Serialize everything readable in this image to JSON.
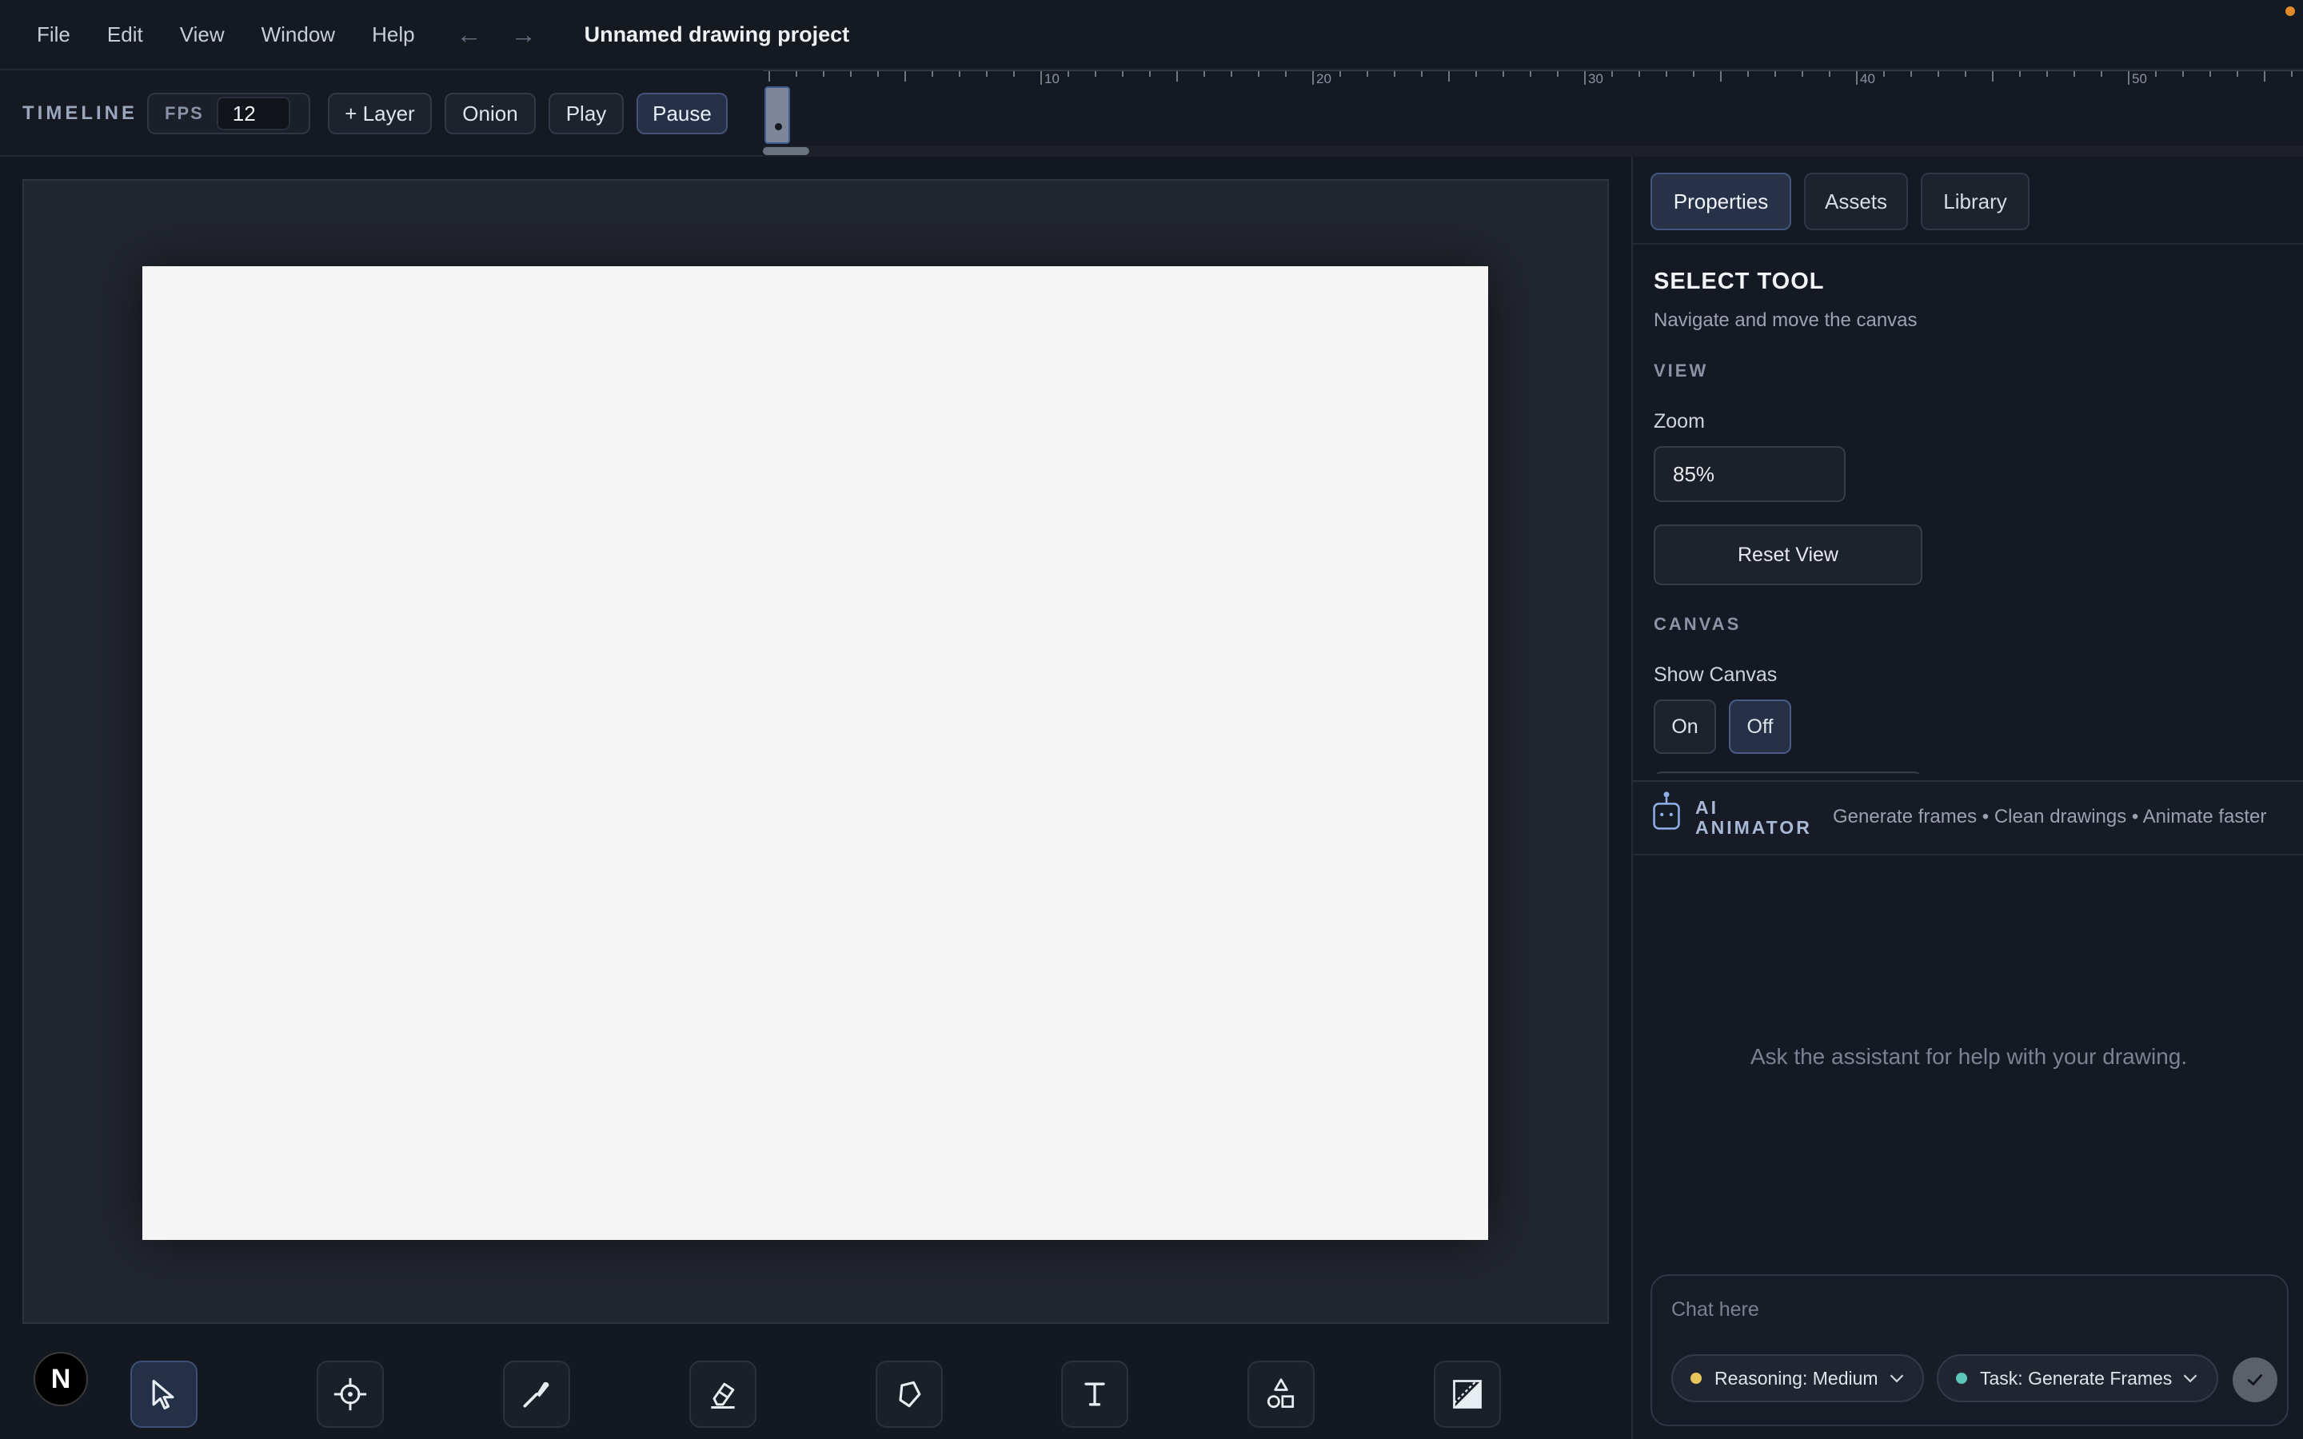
{
  "menu": {
    "items": [
      "File",
      "Edit",
      "View",
      "Window",
      "Help"
    ],
    "undo_glyph": "←",
    "redo_glyph": "→",
    "project_title": "Unnamed drawing project",
    "status_color": "#e58a2c"
  },
  "timeline": {
    "label": "TIMELINE",
    "fps_label": "FPS",
    "fps_value": "12",
    "buttons": {
      "add_layer": "+ Layer",
      "onion": "Onion",
      "play": "Play",
      "pause": "Pause"
    },
    "active_button": "pause",
    "ruler_labels": [
      "10",
      "20",
      "30",
      "40",
      "50"
    ],
    "current_frame": 1
  },
  "toolbar": {
    "brand_letter": "N",
    "tools": [
      {
        "name": "select",
        "icon": "pointer-icon",
        "active": true
      },
      {
        "name": "pan",
        "icon": "crosshair-icon",
        "active": false
      },
      {
        "name": "brush",
        "icon": "brush-icon",
        "active": false
      },
      {
        "name": "eraser",
        "icon": "eraser-icon",
        "active": false
      },
      {
        "name": "fill",
        "icon": "fill-icon",
        "active": false
      },
      {
        "name": "text",
        "icon": "text-icon",
        "active": false
      },
      {
        "name": "shapes",
        "icon": "shapes-icon",
        "active": false
      },
      {
        "name": "gradient",
        "icon": "gradient-icon",
        "active": false
      }
    ]
  },
  "panel": {
    "tabs": [
      "Properties",
      "Assets",
      "Library"
    ],
    "active_tab": "Properties",
    "properties": {
      "title": "SELECT TOOL",
      "description": "Navigate and move the canvas",
      "view_section": "VIEW",
      "zoom_label": "Zoom",
      "zoom_value": "85%",
      "reset_label": "Reset View",
      "canvas_section": "CANVAS",
      "show_canvas_label": "Show Canvas",
      "toggle_on": "On",
      "toggle_off": "Off",
      "toggle_selected": "Off"
    },
    "ai": {
      "title_line1": "AI",
      "title_line2": "ANIMATOR",
      "tagline": "Generate frames • Clean drawings • Animate faster",
      "empty_message": "Ask the assistant for help with your drawing.",
      "chat_placeholder": "Chat here",
      "reasoning_label": "Reasoning: Medium",
      "reasoning_color": "#e7c55a",
      "task_label": "Task: Generate Frames",
      "task_color": "#5fc4b8"
    }
  },
  "colors": {
    "accent": "#3d4f77",
    "paper": "#f5f5f5",
    "background": "#141821"
  }
}
